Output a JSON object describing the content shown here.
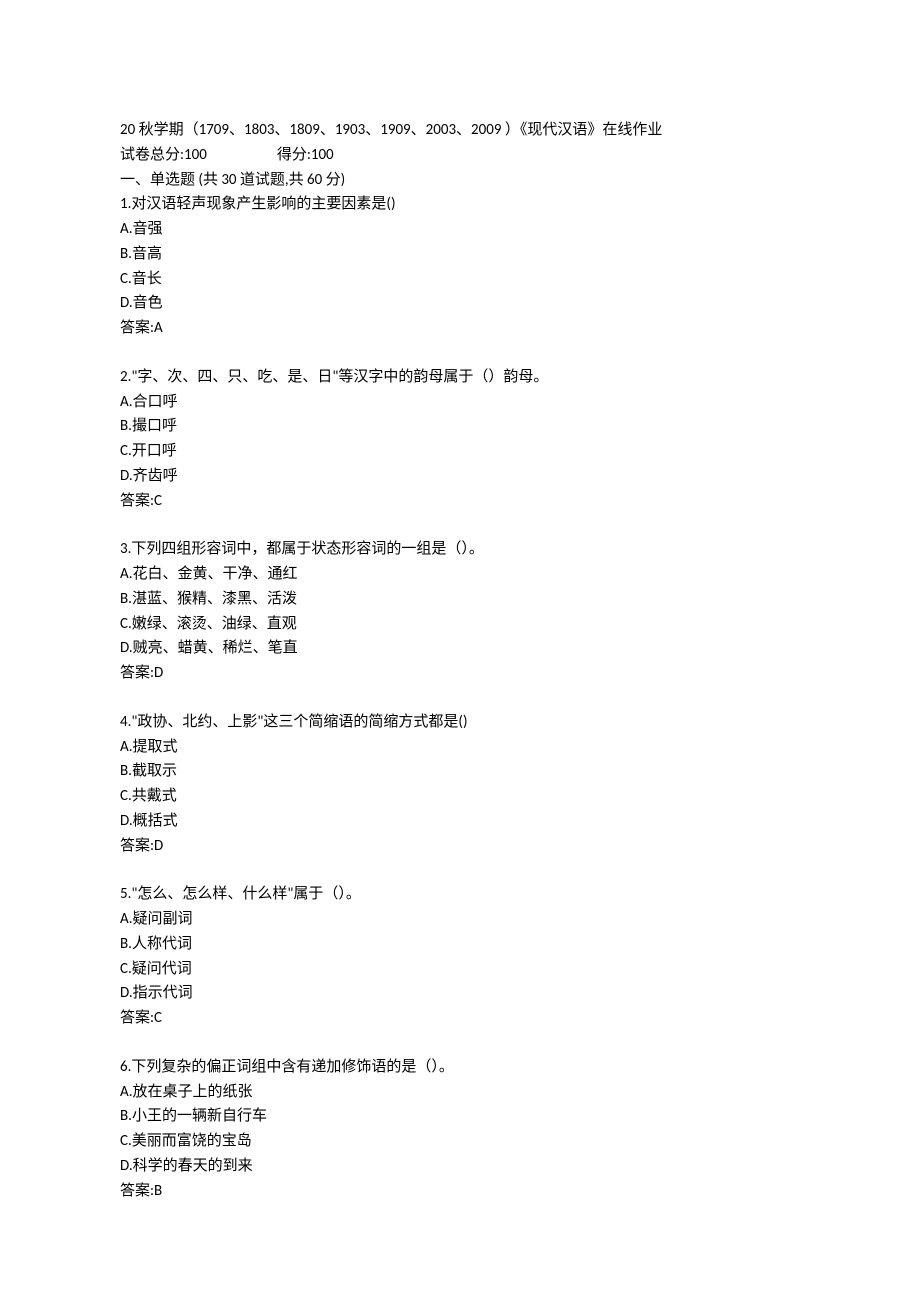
{
  "header": {
    "title_line": "20 秋学期（1709、1803、1809、1903、1909、2003、2009 ）《现代汉语》在线作业",
    "total_label": "试卷总分:100",
    "score_label": "得分:100",
    "section_title": "一、单选题 (共 30 道试题,共 60 分)"
  },
  "questions": [
    {
      "prompt": "1.对汉语轻声现象产生影响的主要因素是()",
      "options": [
        "A.音强",
        "B.音高",
        "C.音长",
        "D.音色"
      ],
      "answer": "答案:A"
    },
    {
      "prompt": "2.\"字、次、四、只、吃、是、日\"等汉字中的韵母属于（）韵母。",
      "options": [
        "A.合口呼",
        "B.撮口呼",
        "C.开口呼",
        "D.齐齿呼"
      ],
      "answer": "答案:C"
    },
    {
      "prompt": "3.下列四组形容词中，都属于状态形容词的一组是（）。",
      "options": [
        "A.花白、金黄、干净、通红",
        "B.湛蓝、猴精、漆黑、活泼",
        "C.嫩绿、滚烫、油绿、直观",
        "D.贼亮、蜡黄、稀烂、笔直"
      ],
      "answer": "答案:D"
    },
    {
      "prompt": "4.\"政协、北约、上影\"这三个简缩语的简缩方式都是()",
      "options": [
        "A.提取式",
        "B.截取示",
        "C.共戴式",
        "D.概括式"
      ],
      "answer": "答案:D"
    },
    {
      "prompt": "5.\"怎么、怎么样、什么样\"属于（）。",
      "options": [
        "A.疑问副词",
        "B.人称代词",
        "C.疑问代词",
        "D.指示代词"
      ],
      "answer": "答案:C"
    },
    {
      "prompt": "6.下列复杂的偏正词组中含有递加修饰语的是（）。",
      "options": [
        "A.放在桌子上的纸张",
        "B.小王的一辆新自行车",
        "C.美丽而富饶的宝岛",
        "D.科学的春天的到来"
      ],
      "answer": "答案:B"
    }
  ]
}
